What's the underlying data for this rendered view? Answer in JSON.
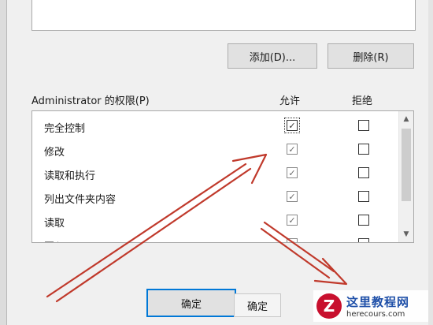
{
  "group_list": {},
  "buttons": {
    "add": "添加(D)...",
    "remove": "删除(R)",
    "ok": "确定",
    "ok_second": "确定"
  },
  "permissions": {
    "header": "Administrator 的权限(P)",
    "allow_label": "允许",
    "deny_label": "拒绝",
    "rows": [
      {
        "label": "完全控制",
        "allow": true,
        "deny": false
      },
      {
        "label": "修改",
        "allow": true,
        "deny": false
      },
      {
        "label": "读取和执行",
        "allow": true,
        "deny": false
      },
      {
        "label": "列出文件夹内容",
        "allow": true,
        "deny": false
      },
      {
        "label": "读取",
        "allow": true,
        "deny": false
      },
      {
        "label": "写入",
        "allow": true,
        "deny": false
      }
    ]
  },
  "icons": {
    "check": "✓",
    "scroll_up": "▲",
    "scroll_down": "▼"
  },
  "watermark": {
    "logo_letter": "Z",
    "name": "这里教程网",
    "domain": "herecours.com"
  },
  "colors": {
    "arrow": "#c0392b",
    "focus": "#0078d7",
    "watermark_red": "#c8102e",
    "watermark_blue": "#1e4fa8"
  }
}
